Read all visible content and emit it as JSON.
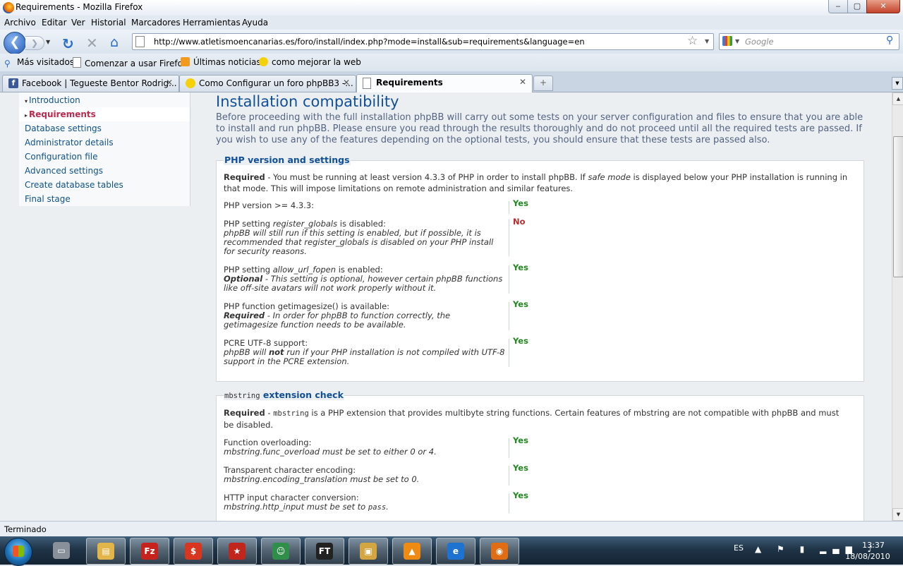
{
  "window": {
    "title": "Requirements - Mozilla Firefox",
    "min": "‒",
    "max": "▢",
    "close": "✕"
  },
  "menu": [
    "Archivo",
    "Editar",
    "Ver",
    "Historial",
    "Marcadores",
    "Herramientas",
    "Ayuda"
  ],
  "nav": {
    "back": "❮",
    "forward": "❯",
    "url": "http://www.atletismoencanarias.es/foro/install/index.php?mode=install&sub=requirements&language=en",
    "search_placeholder": "Google"
  },
  "bookmarks": [
    {
      "label": "Más visitados",
      "icon": "magnifier-icon"
    },
    {
      "label": "Comenzar a usar Firefox",
      "icon": "page-icon"
    },
    {
      "label": "Últimas noticias",
      "icon": "rss-icon"
    },
    {
      "label": "como mejorar la web",
      "icon": "smiley-icon"
    }
  ],
  "tabs": [
    {
      "label": "Facebook | Tegueste Bentor Rodrig...",
      "icon": "facebook-icon",
      "active": false
    },
    {
      "label": "Como Configurar un foro phpBB3 -...",
      "icon": "smiley-icon",
      "active": false
    },
    {
      "label": "Requirements",
      "icon": "page-icon",
      "active": true
    }
  ],
  "sidebar": {
    "items": [
      {
        "label": "Introduction",
        "state": "collapsed"
      },
      {
        "label": "Requirements",
        "state": "active"
      },
      {
        "label": "Database settings"
      },
      {
        "label": "Administrator details"
      },
      {
        "label": "Configuration file"
      },
      {
        "label": "Advanced settings"
      },
      {
        "label": "Create database tables"
      },
      {
        "label": "Final stage"
      }
    ]
  },
  "page": {
    "heading": "Installation compatibility",
    "intro": "Before proceeding with the full installation phpBB will carry out some tests on your server configuration and files to ensure that you are able to install and run phpBB. Please ensure you read through the results thoroughly and do not proceed until all the required tests are passed. If you wish to use any of the features depending on the optional tests, you should ensure that these tests are passed also.",
    "php_section": {
      "legend": "PHP version and settings",
      "required_label": "Required",
      "required_text_a": " - You must be running at least version 4.3.3 of PHP in order to install phpBB. If ",
      "required_italic": "safe mode",
      "required_text_b": " is displayed below your PHP installation is running in that mode. This will impose limitations on remote administration and similar features.",
      "rows": [
        {
          "label": "PHP version >= 4.3.3:",
          "value": "Yes"
        },
        {
          "label_a": "PHP setting ",
          "label_i": "register_globals",
          "label_b": " is disabled:",
          "note": "phpBB will still run if this setting is enabled, but if possible, it is recommended that register_globals is disabled on your PHP install for security reasons.",
          "value": "No"
        },
        {
          "label_a": "PHP setting ",
          "label_i": "allow_url_fopen",
          "label_b": " is enabled:",
          "note_bold": "Optional",
          "note": " - This setting is optional, however certain phpBB functions like off-site avatars will not work properly without it.",
          "value": "Yes"
        },
        {
          "label": "PHP function getimagesize() is available:",
          "note_bold": "Required",
          "note": " - In order for phpBB to function correctly, the getimagesize function needs to be available.",
          "value": "Yes"
        },
        {
          "label": "PCRE UTF-8 support:",
          "note_a": "phpBB will ",
          "note_bold": "not",
          "note_b": " run if your PHP installation is not compiled with UTF-8 support in the PCRE extension.",
          "value": "Yes"
        }
      ]
    },
    "mbstring_section": {
      "legend_code": "mbstring",
      "legend_text": " extension check",
      "required_label": "Required",
      "required_code": "mbstring",
      "required_text": " is a PHP extension that provides multibyte string functions. Certain features of mbstring are not compatible with phpBB and must be disabled.",
      "rows": [
        {
          "label": "Function overloading:",
          "note": "mbstring.func_overload must be set to either 0 or 4.",
          "value": "Yes"
        },
        {
          "label": "Transparent character encoding:",
          "note": "mbstring.encoding_translation must be set to 0.",
          "value": "Yes"
        },
        {
          "label": "HTTP input character conversion:",
          "note_a": "mbstring.http_input must be set to ",
          "note_code": "pass",
          "note_b": ".",
          "value": "Yes"
        }
      ]
    }
  },
  "status": "Terminado",
  "taskbar": {
    "apps": [
      {
        "name": "drive",
        "glyph": "▭",
        "color": "#8a9099"
      },
      {
        "name": "explorer",
        "glyph": "▤",
        "color": "#e1b54a"
      },
      {
        "name": "filezilla",
        "glyph": "Fz",
        "color": "#c8221c"
      },
      {
        "name": "poker",
        "glyph": "$",
        "color": "#d8361f"
      },
      {
        "name": "pokerstars",
        "glyph": "★",
        "color": "#c0261c"
      },
      {
        "name": "messenger",
        "glyph": "☺",
        "color": "#2f8f4a"
      },
      {
        "name": "fulltilt",
        "glyph": "FT",
        "color": "#222222"
      },
      {
        "name": "photos",
        "glyph": "▣",
        "color": "#d4a642"
      },
      {
        "name": "vlc",
        "glyph": "▲",
        "color": "#ef8a12"
      },
      {
        "name": "ie",
        "glyph": "e",
        "color": "#1d73cf"
      },
      {
        "name": "firefox",
        "glyph": "◉",
        "color": "#e06d14"
      }
    ],
    "lang": "ES",
    "tray_icons": "▲ ⚑ ▮ ▂▄▆ ♪",
    "time": "13:37",
    "date": "18/08/2010"
  }
}
